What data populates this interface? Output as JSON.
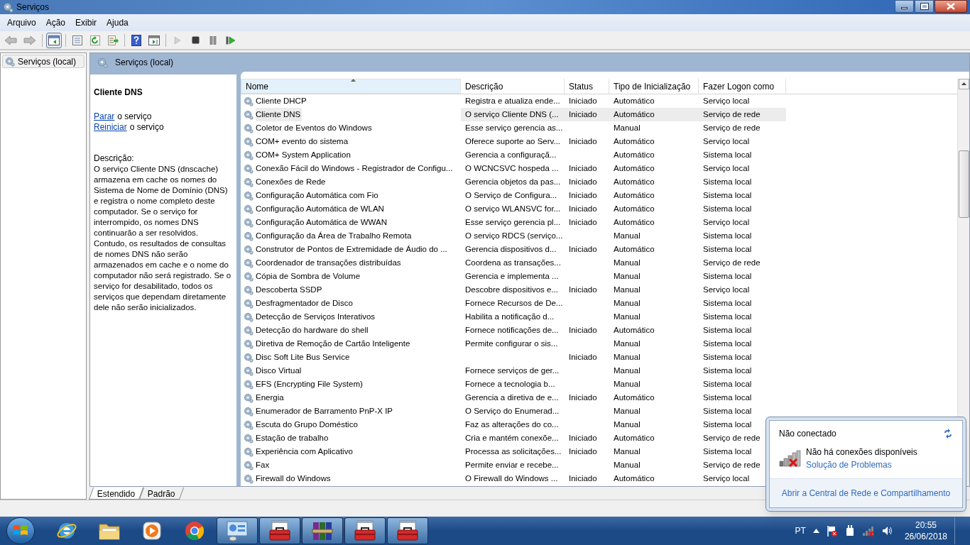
{
  "window": {
    "title": "Serviços"
  },
  "menu": [
    "Arquivo",
    "Ação",
    "Exibir",
    "Ajuda"
  ],
  "toolbar": [
    {
      "kind": "back",
      "disabled": true,
      "pressed": false
    },
    {
      "kind": "forward",
      "disabled": true,
      "pressed": false
    },
    {
      "kind": "tree",
      "disabled": false,
      "pressed": true
    },
    {
      "kind": "properties",
      "disabled": false,
      "pressed": false
    },
    {
      "kind": "refresh",
      "disabled": false,
      "pressed": false
    },
    {
      "kind": "export",
      "disabled": false,
      "pressed": false
    },
    {
      "kind": "help",
      "disabled": false,
      "pressed": false
    },
    {
      "kind": "pane",
      "disabled": false,
      "pressed": false
    },
    {
      "kind": "play",
      "disabled": true,
      "pressed": false
    },
    {
      "kind": "stop",
      "disabled": false,
      "pressed": false
    },
    {
      "kind": "pause",
      "disabled": false,
      "pressed": false
    },
    {
      "kind": "resume",
      "disabled": false,
      "pressed": false
    }
  ],
  "tree": {
    "items": [
      {
        "label": "Serviços (local)",
        "selected": true
      }
    ]
  },
  "panel": {
    "title": "Serviços (local)"
  },
  "details": {
    "title": "Cliente DNS",
    "actions": [
      {
        "link": "Parar",
        "text": "o serviço"
      },
      {
        "link": "Reiniciar",
        "text": "o serviço"
      }
    ],
    "description_label": "Descrição:",
    "description": "O serviço Cliente DNS (dnscache) armazena em cache os nomes do Sistema de Nome de Domínio (DNS) e registra o nome completo deste computador. Se o serviço for interrompido, os nomes DNS continuarão a ser resolvidos. Contudo, os resultados de consultas de nomes DNS não serão armazenados em cache e o nome do computador não será registrado. Se o serviço for desabilitado, todos os serviços que dependam diretamente dele não serão inicializados."
  },
  "table": {
    "columns": [
      {
        "label": "Nome",
        "sorted": true
      },
      {
        "label": "Descrição",
        "sorted": false
      },
      {
        "label": "Status",
        "sorted": false
      },
      {
        "label": "Tipo de Inicialização",
        "sorted": false
      },
      {
        "label": "Fazer Logon como",
        "sorted": false
      }
    ],
    "rows": [
      {
        "name": "Cliente DHCP",
        "description": "Registra e atualiza ende...",
        "status": "Iniciado",
        "startup": "Automático",
        "logon": "Serviço local",
        "selected": false
      },
      {
        "name": "Cliente DNS",
        "description": "O serviço Cliente DNS (...",
        "status": "Iniciado",
        "startup": "Automático",
        "logon": "Serviço de rede",
        "selected": true
      },
      {
        "name": "Coletor de Eventos do Windows",
        "description": "Esse serviço gerencia as...",
        "status": "",
        "startup": "Manual",
        "logon": "Serviço de rede",
        "selected": false
      },
      {
        "name": "COM+ evento do sistema",
        "description": "Oferece suporte ao Serv...",
        "status": "Iniciado",
        "startup": "Automático",
        "logon": "Serviço local",
        "selected": false
      },
      {
        "name": "COM+ System Application",
        "description": "Gerencia a configuraçã...",
        "status": "",
        "startup": "Automático",
        "logon": "Sistema local",
        "selected": false
      },
      {
        "name": "Conexão Fácil do Windows - Registrador de Configu...",
        "description": "O WCNCSVC hospeda ...",
        "status": "Iniciado",
        "startup": "Automático",
        "logon": "Serviço local",
        "selected": false
      },
      {
        "name": "Conexões de Rede",
        "description": "Gerencia objetos da pas...",
        "status": "Iniciado",
        "startup": "Automático",
        "logon": "Sistema local",
        "selected": false
      },
      {
        "name": "Configuração Automática com Fio",
        "description": "O Serviço de Configura...",
        "status": "Iniciado",
        "startup": "Automático",
        "logon": "Sistema local",
        "selected": false
      },
      {
        "name": "Configuração Automática de WLAN",
        "description": "O serviço WLANSVC for...",
        "status": "Iniciado",
        "startup": "Automático",
        "logon": "Sistema local",
        "selected": false
      },
      {
        "name": "Configuração Automática de WWAN",
        "description": "Esse serviço gerencia pl...",
        "status": "Iniciado",
        "startup": "Automático",
        "logon": "Serviço local",
        "selected": false
      },
      {
        "name": "Configuração da Área de Trabalho Remota",
        "description": "O serviço RDCS (serviço...",
        "status": "",
        "startup": "Manual",
        "logon": "Sistema local",
        "selected": false
      },
      {
        "name": "Construtor de Pontos de Extremidade de Áudio do ...",
        "description": "Gerencia dispositivos d...",
        "status": "Iniciado",
        "startup": "Automático",
        "logon": "Sistema local",
        "selected": false
      },
      {
        "name": "Coordenador de transações distribuídas",
        "description": "Coordena as transações...",
        "status": "",
        "startup": "Manual",
        "logon": "Serviço de rede",
        "selected": false
      },
      {
        "name": "Cópia de Sombra de Volume",
        "description": "Gerencia e implementa ...",
        "status": "",
        "startup": "Manual",
        "logon": "Sistema local",
        "selected": false
      },
      {
        "name": "Descoberta SSDP",
        "description": "Descobre dispositivos e...",
        "status": "Iniciado",
        "startup": "Manual",
        "logon": "Serviço local",
        "selected": false
      },
      {
        "name": "Desfragmentador de Disco",
        "description": "Fornece Recursos de De...",
        "status": "",
        "startup": "Manual",
        "logon": "Sistema local",
        "selected": false
      },
      {
        "name": "Detecção de Serviços Interativos",
        "description": "Habilita a notificação d...",
        "status": "",
        "startup": "Manual",
        "logon": "Sistema local",
        "selected": false
      },
      {
        "name": "Detecção do hardware do shell",
        "description": "Fornece notificações de...",
        "status": "Iniciado",
        "startup": "Automático",
        "logon": "Sistema local",
        "selected": false
      },
      {
        "name": "Diretiva de Remoção de Cartão Inteligente",
        "description": "Permite configurar o sis...",
        "status": "",
        "startup": "Manual",
        "logon": "Sistema local",
        "selected": false
      },
      {
        "name": "Disc Soft Lite Bus Service",
        "description": "",
        "status": "Iniciado",
        "startup": "Manual",
        "logon": "Sistema local",
        "selected": false
      },
      {
        "name": "Disco Virtual",
        "description": "Fornece serviços de ger...",
        "status": "",
        "startup": "Manual",
        "logon": "Sistema local",
        "selected": false
      },
      {
        "name": "EFS (Encrypting File System)",
        "description": "Fornece a tecnologia b...",
        "status": "",
        "startup": "Manual",
        "logon": "Sistema local",
        "selected": false
      },
      {
        "name": "Energia",
        "description": "Gerencia a diretiva de e...",
        "status": "Iniciado",
        "startup": "Automático",
        "logon": "Sistema local",
        "selected": false
      },
      {
        "name": "Enumerador de Barramento PnP-X IP",
        "description": "O Serviço do Enumerad...",
        "status": "",
        "startup": "Manual",
        "logon": "Sistema local",
        "selected": false
      },
      {
        "name": "Escuta do Grupo Doméstico",
        "description": "Faz as alterações do co...",
        "status": "",
        "startup": "Manual",
        "logon": "Sistema local",
        "selected": false
      },
      {
        "name": "Estação de trabalho",
        "description": "Cria e mantém conexõe...",
        "status": "Iniciado",
        "startup": "Automático",
        "logon": "Serviço de rede",
        "selected": false
      },
      {
        "name": "Experiência com Aplicativo",
        "description": "Processa as solicitações...",
        "status": "Iniciado",
        "startup": "Manual",
        "logon": "Sistema local",
        "selected": false
      },
      {
        "name": "Fax",
        "description": "Permite enviar e recebe...",
        "status": "",
        "startup": "Manual",
        "logon": "Serviço de rede",
        "selected": false
      },
      {
        "name": "Firewall do Windows",
        "description": "O Firewall do Windows ...",
        "status": "Iniciado",
        "startup": "Automático",
        "logon": "Serviço local",
        "selected": false
      }
    ]
  },
  "view_tabs": [
    {
      "label": "Estendido",
      "selected": true
    },
    {
      "label": "Padrão",
      "selected": false
    }
  ],
  "network_popup": {
    "title": "Não conectado",
    "message": "Não há conexões disponíveis",
    "link": "Solução de Problemas",
    "footer_link": "Abrir a Central de Rede e Compartilhamento"
  },
  "taskbar": {
    "items": [
      {
        "kind": "ie",
        "running": false
      },
      {
        "kind": "folder",
        "running": false
      },
      {
        "kind": "media",
        "running": false
      },
      {
        "kind": "chrome",
        "running": false
      },
      {
        "kind": "services",
        "running": true
      },
      {
        "kind": "toolbox",
        "running": true
      },
      {
        "kind": "archive",
        "running": true
      },
      {
        "kind": "toolbox",
        "running": true
      },
      {
        "kind": "toolbox",
        "running": true
      }
    ],
    "language": "PT",
    "time": "20:55",
    "date": "26/06/2018"
  }
}
